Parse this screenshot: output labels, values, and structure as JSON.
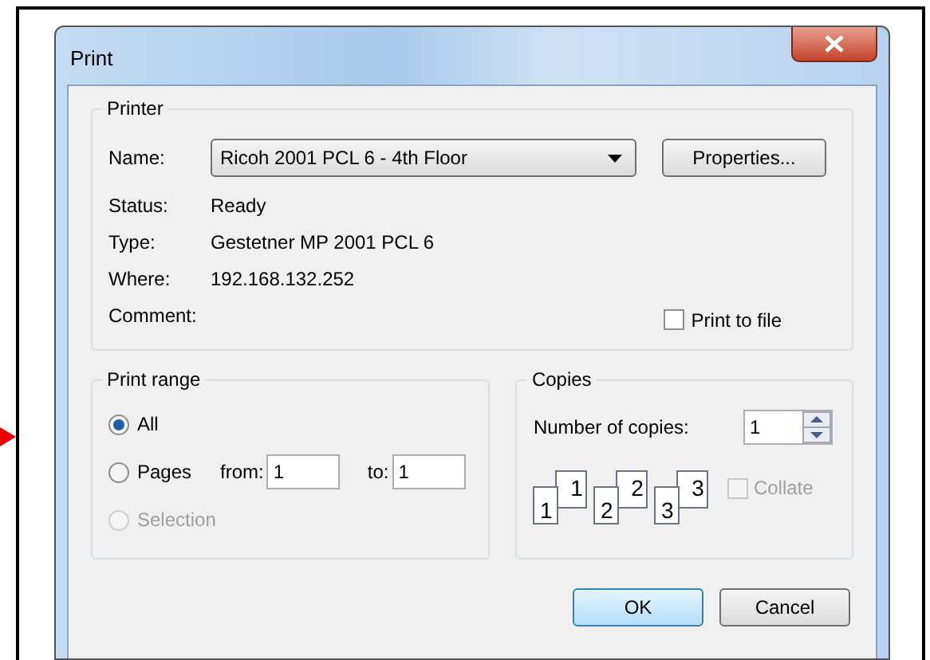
{
  "window": {
    "title": "Print"
  },
  "printer": {
    "legend": "Printer",
    "name_label": "Name:",
    "name_value": "Ricoh 2001 PCL 6 - 4th Floor",
    "properties_button": "Properties...",
    "info": [
      {
        "label": "Status:",
        "value": "Ready"
      },
      {
        "label": "Type:",
        "value": "Gestetner MP 2001 PCL 6"
      },
      {
        "label": "Where:",
        "value": "192.168.132.252"
      },
      {
        "label": "Comment:"
      }
    ],
    "print_to_file": {
      "label": "Print to file",
      "checked": false
    }
  },
  "print_range": {
    "legend": "Print range",
    "options": [
      {
        "kind": "plain",
        "label": "All",
        "selected": true,
        "disabled": false
      },
      {
        "kind": "pages",
        "label": "Pages",
        "selected": false,
        "disabled": false,
        "from_label": "from:",
        "from_value": "1",
        "to_label": "to:",
        "to_value": "1"
      },
      {
        "kind": "plain",
        "label": "Selection",
        "selected": false,
        "disabled": true
      }
    ]
  },
  "copies": {
    "legend": "Copies",
    "number_label": "Number of copies:",
    "number_value": "1",
    "collate_pages": [
      [
        "1",
        "1"
      ],
      [
        "2",
        "2"
      ],
      [
        "3",
        "3"
      ]
    ],
    "collate": {
      "label": "Collate",
      "checked": false,
      "disabled": true
    }
  },
  "buttons": [
    {
      "label": "OK",
      "default": true
    },
    {
      "label": "Cancel",
      "default": false
    }
  ]
}
